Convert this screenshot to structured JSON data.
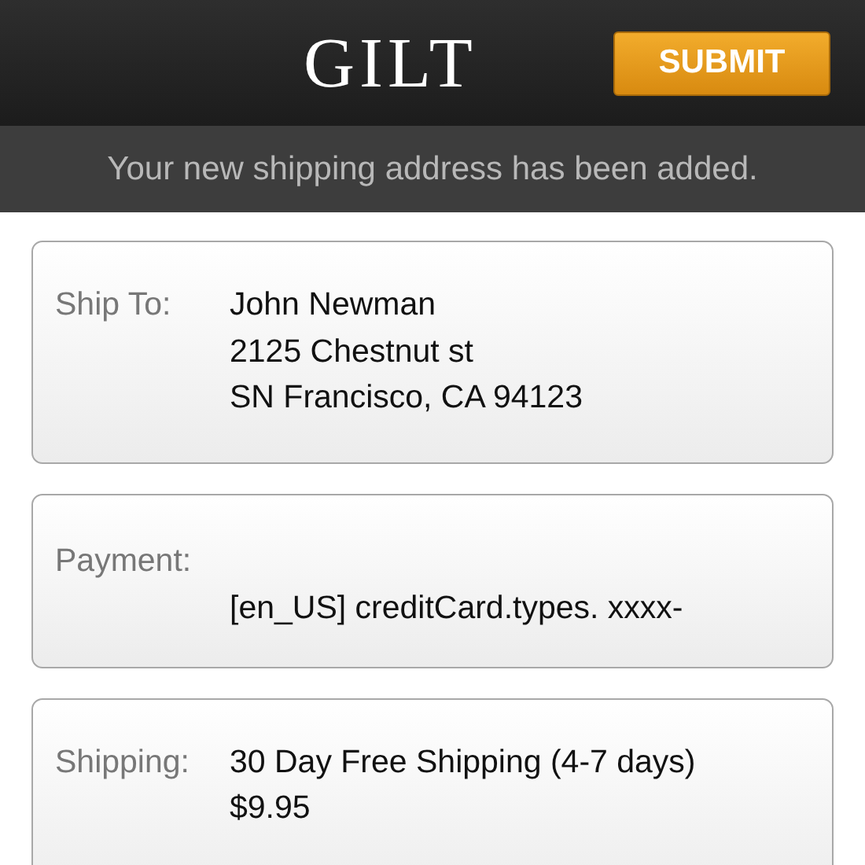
{
  "header": {
    "logo": "GILT",
    "submit_button": "SUBMIT"
  },
  "notice": "Your new shipping address has been added.",
  "cards": [
    {
      "kind": "inline",
      "label": "Ship To:",
      "lines": [
        "John Newman",
        "2125 Chestnut st",
        "SN Francisco, CA  94123"
      ]
    },
    {
      "kind": "stacked",
      "label": "Payment:",
      "lines": [
        "[en_US] creditCard.types. xxxx-"
      ]
    },
    {
      "kind": "inline",
      "label": "Shipping:",
      "lines": [
        "30 Day Free Shipping (4-7 days)",
        "$9.95"
      ]
    }
  ]
}
